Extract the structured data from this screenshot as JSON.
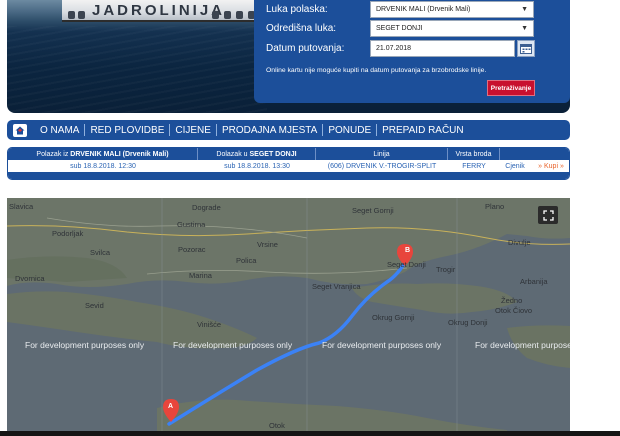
{
  "hero": {
    "ship_name": "JADROLINIJA"
  },
  "booking": {
    "departure_label": "Luka polaska:",
    "departure_value": "DRVENIK MALI (Drvenik Mali)",
    "destination_label": "Odredišna luka:",
    "destination_value": "SEGET DONJI",
    "date_label": "Datum putovanja:",
    "date_value": "21.07.2018",
    "note": "Online kartu nije moguće kupiti na datum putovanja za brzobrodske linije.",
    "search_label": "Pretraživanje"
  },
  "nav": {
    "items": [
      "O NAMA",
      "RED PLOVIDBE",
      "CIJENE",
      "PRODAJNA MJESTA",
      "PONUDE",
      "PREPAID RAČUN"
    ]
  },
  "results": {
    "head_departure_prefix": "Polazak iz",
    "head_departure_port": "DRVENIK MALI (Drvenik Mali)",
    "head_arrival_prefix": "Dolazak u",
    "head_arrival_port": "SEGET DONJI",
    "head_line": "Linija",
    "head_vessel": "Vrsta broda",
    "row": {
      "departure": "sub 18.8.2018. 12:30",
      "arrival": "sub 18.8.2018. 13:30",
      "line": "(606) DRVENIK V.-TROGIR-SPLIT",
      "vessel": "FERRY",
      "price_link": "Cjenik",
      "buy_link": "» Kupi »"
    }
  },
  "map": {
    "dev_text": "For development purposes only",
    "marker_a": "A",
    "marker_b": "B",
    "labels": {
      "slavica": "Slavica",
      "dograde": "Dograde",
      "seget_gornji": "Seget Gornji",
      "plano": "Plano",
      "podorljak": "Podorljak",
      "gustirna": "Gustirna",
      "svilca": "Svilca",
      "pozorac": "Pozorac",
      "vrsine": "Vrsine",
      "divulje": "Divulje",
      "polica": "Polica",
      "seget_donji": "Seget Donji",
      "trogir": "Trogir",
      "dvornica": "Dvornica",
      "marina": "Marina",
      "arbanija": "Arbanija",
      "seget_vranjica": "Seget Vranjica",
      "sevid": "Sevid",
      "okrug_gornji": "Okrug Gornji",
      "okrug_donji": "Okrug Donji",
      "zedno": "Žedno",
      "otok_ciovo": "Otok Čiovo",
      "vinisce": "Vinišće",
      "otok": "Otok"
    }
  },
  "colors": {
    "brand_blue": "#1c4f9a",
    "accent_red": "#c8102e",
    "route_blue": "#3b82f6"
  }
}
